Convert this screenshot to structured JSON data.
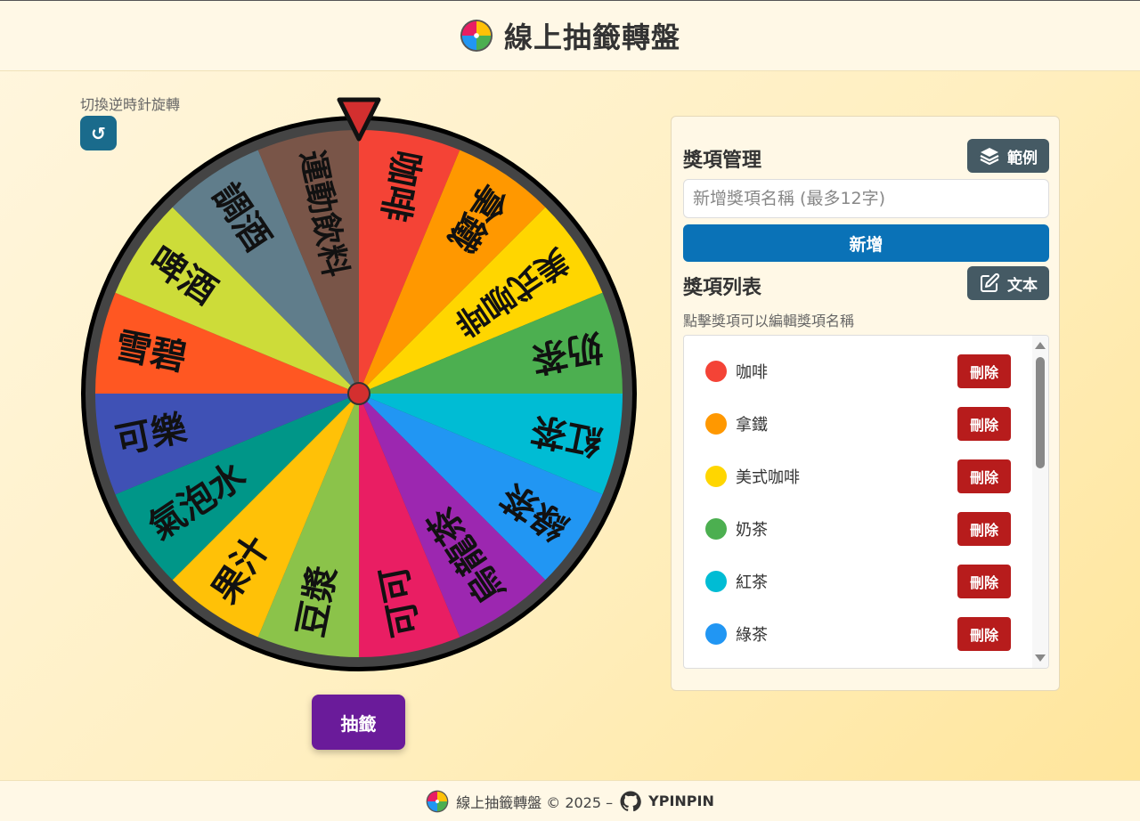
{
  "header": {
    "title": "線上抽籤轉盤",
    "logo_icon": "color-wheel-logo-icon"
  },
  "controls": {
    "rotate_label": "切換逆時針旋轉",
    "rotate_icon": "↺",
    "draw_label": "抽籤"
  },
  "wheel": {
    "segments": [
      {
        "label": "咖啡",
        "color": "#F44336"
      },
      {
        "label": "拿鐵",
        "color": "#FF9800"
      },
      {
        "label": "美式咖啡",
        "color": "#FFD600"
      },
      {
        "label": "奶茶",
        "color": "#4CAF50"
      },
      {
        "label": "紅茶",
        "color": "#00BCD4"
      },
      {
        "label": "綠茶",
        "color": "#2196F3"
      },
      {
        "label": "烏龍茶",
        "color": "#9C27B0"
      },
      {
        "label": "可可",
        "color": "#E91E63"
      },
      {
        "label": "豆漿",
        "color": "#8BC34A"
      },
      {
        "label": "果汁",
        "color": "#FFC107"
      },
      {
        "label": "氣泡水",
        "color": "#009688"
      },
      {
        "label": "可樂",
        "color": "#3F51B5"
      },
      {
        "label": "雪碧",
        "color": "#FF5722"
      },
      {
        "label": "啤酒",
        "color": "#CDDC39"
      },
      {
        "label": "調酒",
        "color": "#607D8B"
      },
      {
        "label": "運動飲料",
        "color": "#795548"
      }
    ]
  },
  "panel": {
    "manage_title": "獎項管理",
    "example_button": "範例",
    "input_placeholder": "新增獎項名稱 (最多12字)",
    "add_button": "新增",
    "list_title": "獎項列表",
    "text_button": "文本",
    "hint": "點擊獎項可以編輯獎項名稱",
    "delete_label": "刪除",
    "items": [
      {
        "label": "咖啡",
        "color": "#F44336"
      },
      {
        "label": "拿鐵",
        "color": "#FF9800"
      },
      {
        "label": "美式咖啡",
        "color": "#FFD600"
      },
      {
        "label": "奶茶",
        "color": "#4CAF50"
      },
      {
        "label": "紅茶",
        "color": "#00BCD4"
      },
      {
        "label": "綠茶",
        "color": "#2196F3"
      }
    ]
  },
  "footer": {
    "text": "線上抽籤轉盤 © 2025 –",
    "brand": "YPINPIN"
  }
}
